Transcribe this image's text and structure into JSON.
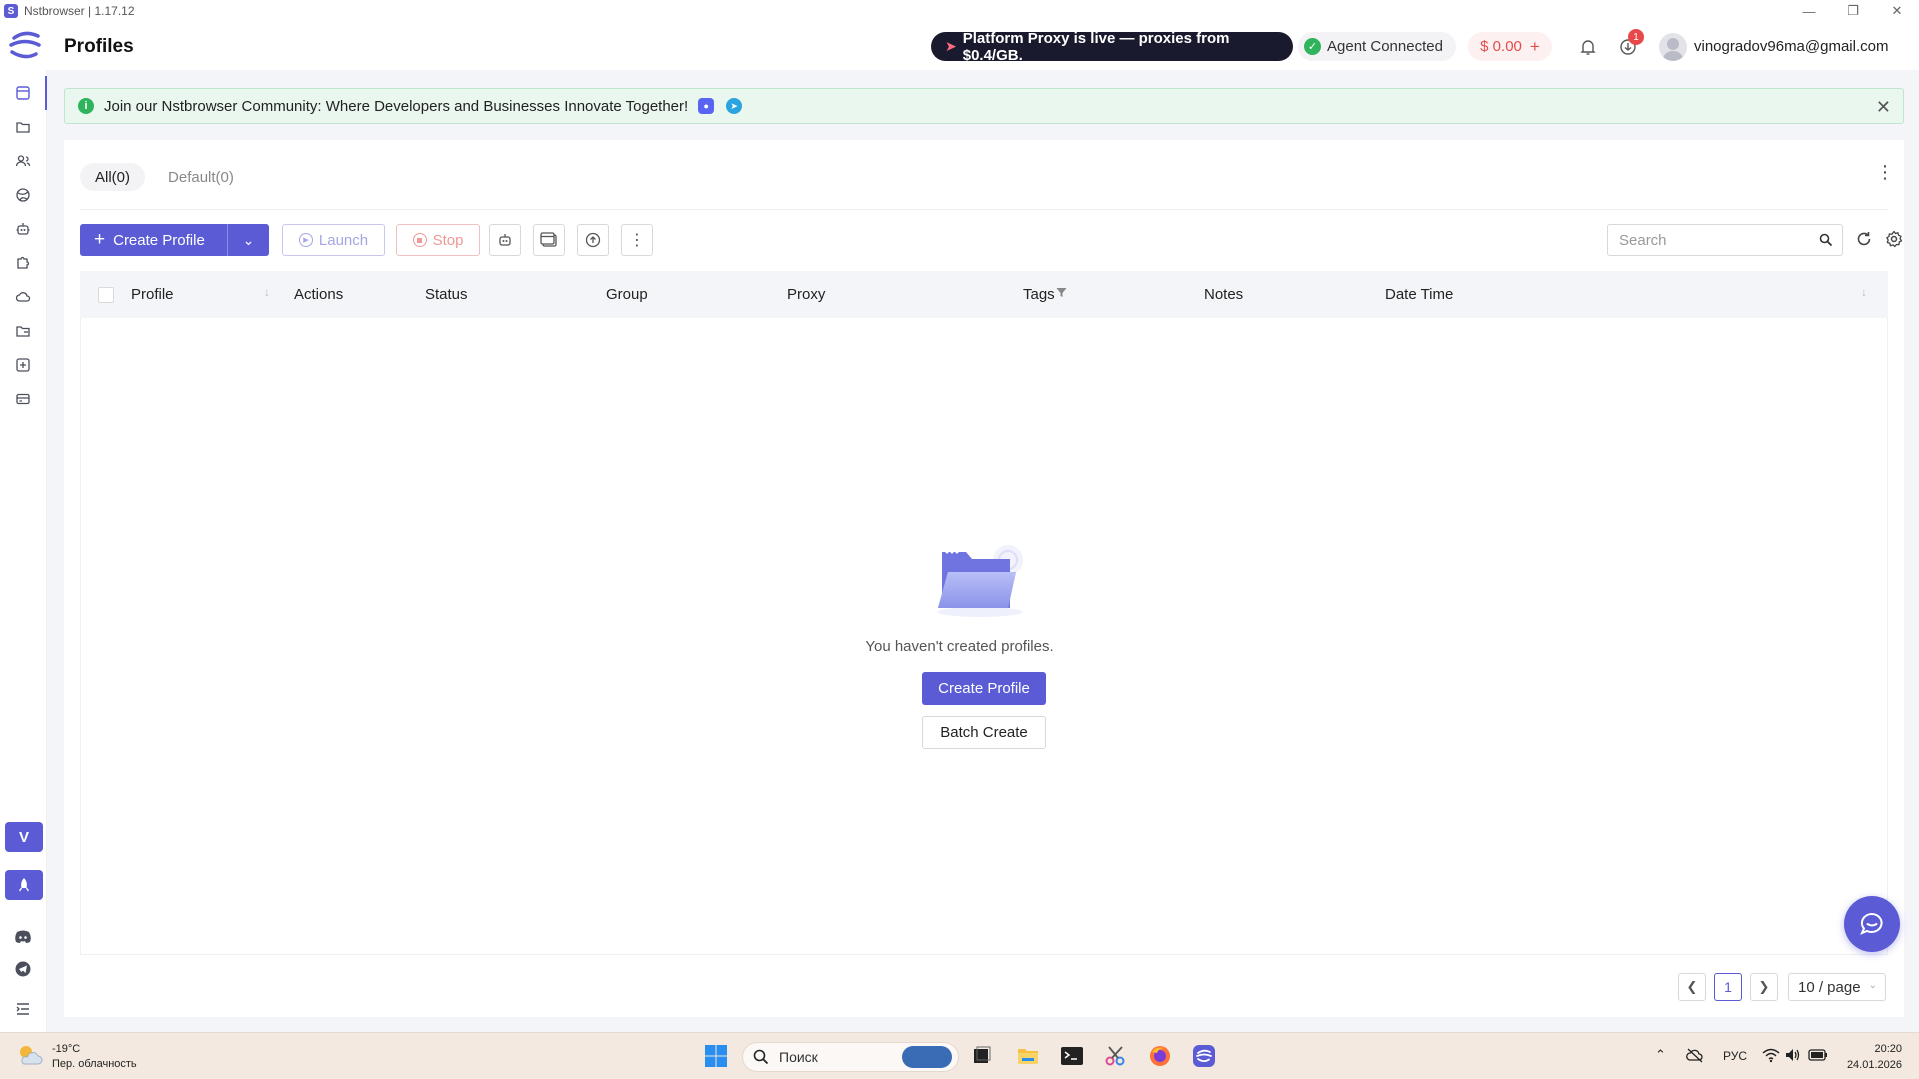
{
  "window": {
    "title": "Nstbrowser | 1.17.12",
    "controls": [
      "minimize",
      "restore",
      "close"
    ]
  },
  "header": {
    "page_title": "Profiles",
    "promo": "Platform Proxy is live — proxies from $0.4/GB.",
    "agent_status": "Agent Connected",
    "balance": "$ 0.00",
    "balance_add": "+",
    "download_badge": "1",
    "user_email": "vinogradov96ma@gmail.com"
  },
  "sidebar": {
    "items": [
      "profiles-icon",
      "folder-icon",
      "team-icon",
      "proxy-globe-icon",
      "automation-robot-icon",
      "extensions-puzzle-icon",
      "cloud-icon",
      "tags-folder-icon",
      "add-square-icon",
      "billing-card-icon"
    ],
    "bottom_badge_v": "V",
    "bottom_badge_rocket": "rocket-icon"
  },
  "banner": {
    "text": "Join our Nstbrowser Community: Where Developers and Businesses Innovate Together!"
  },
  "tabs": [
    {
      "label": "All(0)",
      "active": true
    },
    {
      "label": "Default(0)",
      "active": false
    }
  ],
  "toolbar": {
    "create_label": "Create Profile",
    "launch_label": "Launch",
    "stop_label": "Stop",
    "search_placeholder": "Search"
  },
  "table": {
    "columns": [
      "Profile",
      "Actions",
      "Status",
      "Group",
      "Proxy",
      "Tags",
      "Notes",
      "Date Time"
    ],
    "rows": []
  },
  "empty_state": {
    "message": "You haven't created profiles.",
    "create_label": "Create Profile",
    "batch_label": "Batch Create"
  },
  "pagination": {
    "current_page": "1",
    "page_size": "10 / page"
  },
  "taskbar": {
    "temperature": "-19°C",
    "weather_desc": "Пер. облачность",
    "search_placeholder": "Поиск",
    "language": "РУС",
    "time": "20:20",
    "date": "24.01.2026"
  },
  "colors": {
    "accent": "#5b5bd6",
    "success": "#2fb35d",
    "danger": "#e34c4c",
    "banner_bg": "#eaf7ef"
  }
}
